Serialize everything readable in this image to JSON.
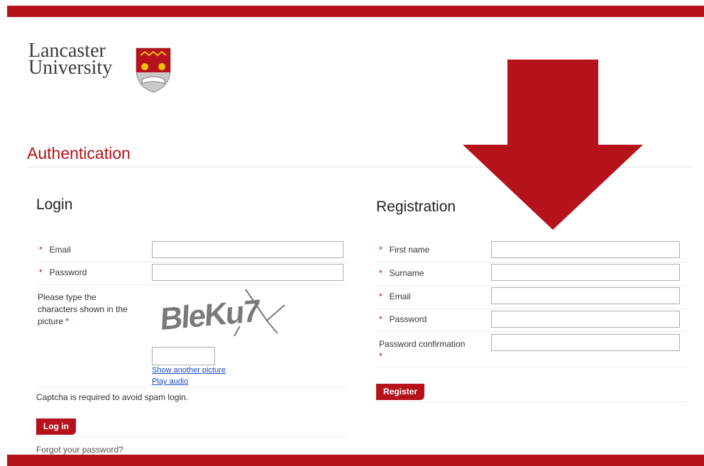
{
  "brand": {
    "line1": "Lancaster",
    "line2": "University",
    "accent": "#b5121b"
  },
  "page": {
    "title": "Authentication"
  },
  "login": {
    "title": "Login",
    "email_label": "Email",
    "password_label": "Password",
    "captcha_label": "Please type the characters shown in the picture",
    "captcha_text": "BleKu7",
    "show_another": "Show another picture",
    "play_audio": "Play audio",
    "captcha_note": "Captcha is required to avoid spam login.",
    "submit_label": "Log in",
    "forgot_label": "Forgot your password?"
  },
  "registration": {
    "title": "Registration",
    "first_name_label": "First name",
    "surname_label": "Surname",
    "email_label": "Email",
    "password_label": "Password",
    "confirm_label": "Password confirmation",
    "submit_label": "Register"
  },
  "required_marker": "*",
  "icons": {
    "arrow": "down-arrow-icon",
    "shield": "university-crest-icon"
  }
}
